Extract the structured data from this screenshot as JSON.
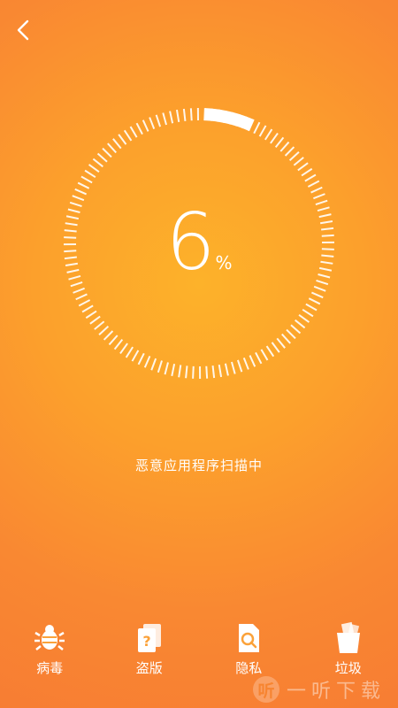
{
  "header": {
    "back_icon": "chevron-left-icon"
  },
  "scan": {
    "progress_value": "6",
    "progress_unit": "%",
    "progress_fraction": 0.06,
    "status_text": "恶意应用程序扫描中"
  },
  "nav": {
    "items": [
      {
        "label": "病毒",
        "icon": "bug-icon"
      },
      {
        "label": "盗版",
        "icon": "pirate-doc-icon"
      },
      {
        "label": "隐私",
        "icon": "privacy-search-icon"
      },
      {
        "label": "垃圾",
        "icon": "trash-icon"
      }
    ]
  },
  "watermark": {
    "logo_char": "听",
    "text": "一听下载"
  },
  "colors": {
    "background": "#fca02c",
    "tick": "#ffffff"
  }
}
